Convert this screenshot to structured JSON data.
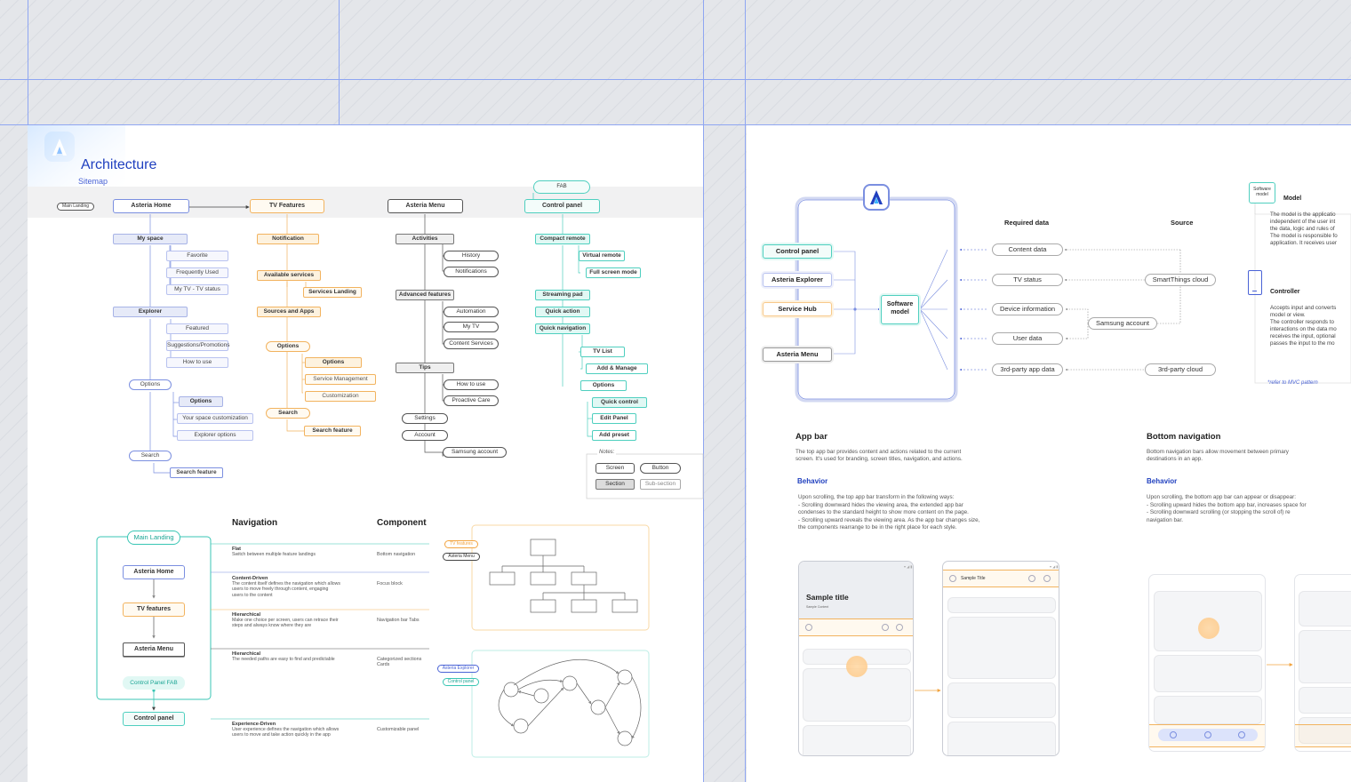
{
  "colors": {
    "blue": "#4a63d6",
    "orange": "#f2a440",
    "teal": "#39c6b4",
    "gray": "#555555"
  },
  "brand": {
    "logo": "asteria-logo-icon",
    "title": "Architecture",
    "subtitle": "Sitemap"
  },
  "sitemap": {
    "main_landing_tag": "Main Landing",
    "home": {
      "title": "Asteria Home",
      "my_space": "My space",
      "favorite": "Favorite",
      "frequently_used": "Frequently Used",
      "my_tv": "My TV - TV status",
      "explorer": "Explorer",
      "featured": "Featured",
      "suggestions": "Suggestions/Promotions",
      "how_to_use": "How to use",
      "options": "Options",
      "options_sub": "Options",
      "space_custom": "Your space customization",
      "explorer_options": "Explorer options",
      "search": "Search",
      "search_feature": "Search feature"
    },
    "features": {
      "title": "TV Features",
      "notification": "Notification",
      "available_services": "Available services",
      "services_landing": "Services Landing",
      "sources_apps": "Sources and Apps",
      "options": "Options",
      "options_sub": "Options",
      "service_mgmt": "Service Management",
      "customization": "Customization",
      "search": "Search",
      "search_feature": "Search feature"
    },
    "menu": {
      "title": "Asteria Menu",
      "activities": "Activities",
      "history": "History",
      "notifications": "Notifications",
      "advanced": "Advanced features",
      "automation": "Automation",
      "my_tv": "My TV",
      "content_services": "Content Services",
      "tips": "Tips",
      "how_to_use": "How to use",
      "proactive_care": "Proactive Care",
      "settings": "Settings",
      "account": "Account",
      "samsung_account": "Samsung account"
    },
    "control": {
      "fab": "FAB",
      "title": "Control panel",
      "compact_remote": "Compact remote",
      "virtual_remote": "Virtual remote",
      "full_screen": "Full screen mode",
      "streaming_pad": "Streaming pad",
      "quick_action": "Quick action",
      "quick_navigation": "Quick navigation",
      "tv_list": "TV List",
      "add_manage": "Add & Manage",
      "options": "Options",
      "quick_control": "Quick control",
      "edit_panel": "Edit Panel",
      "add_preset": "Add preset"
    },
    "notes": {
      "title": "Notes:",
      "screen": "Screen",
      "button": "Button",
      "section": "Section",
      "subsection": "Sub-section"
    }
  },
  "nav_diagram": {
    "main_landing": "Main Landing",
    "home": "Asteria Home",
    "features": "TV features",
    "menu": "Asteria Menu",
    "fab": "Control Panel FAB",
    "control": "Control panel",
    "col_nav": "Navigation",
    "col_comp": "Component",
    "rows": [
      {
        "title": "Flat",
        "desc": "Switch between multiple feature landings",
        "comp": "Bottom navigation"
      },
      {
        "title": "Content-Driven",
        "desc": "The content itself defines the navigation which allows users to move freely through content, engaging users to the content",
        "comp": "Focus block"
      },
      {
        "title": "Hierarchical",
        "desc": "Make one choice per screen, users can retrace their steps and always know where they are",
        "comp": "Navigation bar Tabs"
      },
      {
        "title": "Hierarchical",
        "desc": "The needed paths are easy to find and predictable",
        "comp": "Categorized sections Cards"
      },
      {
        "title": "Experience-Driven",
        "desc": "User experience defines the navigation which allows users to move and take action quickly in the app",
        "comp": "Customizable panel"
      }
    ],
    "tags": {
      "tv_features": "TV features",
      "asteria_menu": "Asteria Menu",
      "asteria_explorer": "Asteria Explorer",
      "control_panel": "Control panel"
    }
  },
  "data_flow": {
    "apps": [
      "Control panel",
      "Asteria Explorer",
      "Service Hub",
      "Asteria Menu"
    ],
    "software_model": "Software model",
    "required_header": "Required data",
    "source_header": "Source",
    "required": [
      "Content data",
      "TV status",
      "Device information",
      "User data",
      "3rd-party app data"
    ],
    "sources": [
      "SmartThings cloud",
      "Samsung account",
      "3rd-party cloud"
    ]
  },
  "mvc": {
    "sw_model_tag": "Software model",
    "model_title": "Model",
    "model_text": [
      "The model is the applicatio",
      "independent of the user int",
      "the data, logic and rules of",
      "The model is responsible fo",
      "application. It receives user"
    ],
    "controller_title": "Controller",
    "controller_text": [
      "Accepts input and converts",
      "model or view.",
      "The controller responds to",
      "interactions on the data mo",
      "receives the input, optional",
      "passes the input to the mo"
    ],
    "refer": "*refer to MVC pattern"
  },
  "appbar": {
    "title": "App bar",
    "desc": [
      "The top app bar provides content and actions related to the current",
      "screen. It's used for branding, screen titles, navigation, and actions."
    ],
    "behavior": "Behavior",
    "lines": [
      "Upon scrolling, the top app bar transform in the following ways:",
      "- Scrolling downward hides the viewing area, the extended app bar",
      "condenses to the standard height to show more content on the page.",
      "- Scrolling upward reveals the viewing area. As the app bar changes size,",
      "the components rearrange to be in the right place for each style."
    ],
    "sample_title": "Sample title",
    "sample_content": "Sample Content",
    "sample_small": "Sample Title"
  },
  "bottomnav": {
    "title": "Bottom navigation",
    "desc": [
      "Bottom navigation bars allow movement between primary",
      "destinations in an app."
    ],
    "behavior": "Behavior",
    "lines": [
      "Upon scrolling, the bottom app bar can appear or disappear:",
      "- Scrolling upward hides the bottom app bar, increases space for",
      "- Scrolling downward scrolling (or stopping the scroll of) re",
      "navigation bar."
    ]
  }
}
